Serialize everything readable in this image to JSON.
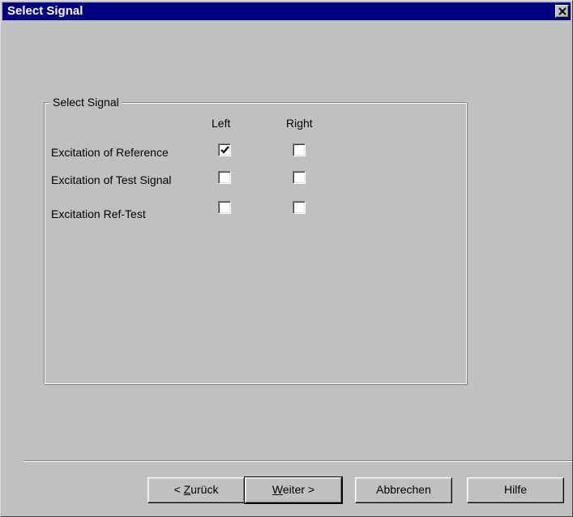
{
  "window": {
    "title": "Select Signal",
    "title_bar_color": "#000080",
    "close_icon": "close-icon"
  },
  "group": {
    "label": "Select Signal",
    "columns": [
      "Left",
      "Right"
    ],
    "rows": [
      {
        "label": "Excitation of Reference",
        "left_checked": true,
        "right_checked": false
      },
      {
        "label": "Excitation of Test Signal",
        "left_checked": false,
        "right_checked": false
      },
      {
        "label": "Excitation Ref-Test",
        "left_checked": false,
        "right_checked": false
      }
    ]
  },
  "buttons": {
    "back": {
      "prefix": "< ",
      "mnemonic": "Z",
      "rest": "urück"
    },
    "next": {
      "mnemonic": "W",
      "rest": "eiter",
      "suffix": " >"
    },
    "cancel": "Abbrechen",
    "help": "Hilfe"
  }
}
